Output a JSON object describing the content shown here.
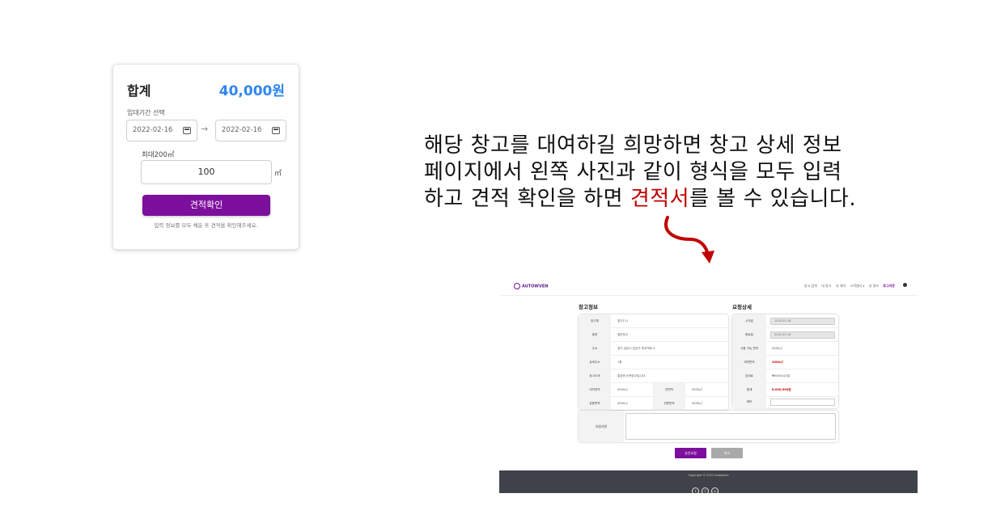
{
  "quote_card": {
    "sum_label": "합계",
    "sum_value": "40,000원",
    "period_label": "임대기간 선택",
    "date_from": "2022-02-16",
    "date_to": "2022-02-16",
    "arrow": "→",
    "max_label": "최대200㎡",
    "area_value": "100",
    "unit": "㎡",
    "button_label": "견적확인",
    "hint": "입력 정보를 모두 채운 후 견적을 확인해주세요."
  },
  "explanation": {
    "line1": "해당 창고를 대여하길 희망하면 창고 상세 정보",
    "line2": "페이지에서 왼쪽 사진과 같이 형식을 모두 입력",
    "line3_pre": "하고 견적 확인을 하면 ",
    "line3_highlight": "견적서",
    "line3_post": "를 볼 수 있습니다.",
    "highlight_color": "#c00000"
  },
  "screenshot": {
    "logo": "AUTOWVEN",
    "nav": [
      "창고 검색",
      "내 창고",
      "내 계약",
      "고객센터 ▾",
      "내 정보",
      "로그아웃"
    ],
    "warehouse_title": "창고정보",
    "request_title": "요청상세",
    "warehouse_rows": [
      {
        "k": "창고명",
        "v": "창고111"
      },
      {
        "k": "종류",
        "v": "일반창고"
      },
      {
        "k": "주소",
        "v": "경기 성남시 분당구 판교역로 4"
      },
      {
        "k": "상세주소",
        "v": "1층"
      },
      {
        "k": "창고소개",
        "v": "깔끔한 신축창고입니다."
      }
    ],
    "warehouse_pairs": [
      {
        "k1": "대지면적",
        "v1": "4000㎡",
        "k2": "연면적",
        "v2": "4000㎡"
      },
      {
        "k1": "공용면적",
        "v1": "4000㎡",
        "k2": "전용면적",
        "v2": "4000㎡"
      }
    ],
    "request_rows": [
      {
        "k": "시작일",
        "v": "2022-02-16"
      },
      {
        "k": "종료일",
        "v": "2022-02-16"
      },
      {
        "k": "사용 가능 면적",
        "v": "4000㎡"
      },
      {
        "k": "계약면적",
        "v": "2000㎡"
      },
      {
        "k": "임대료",
        "v": "₩4000/㎡/일"
      },
      {
        "k": "합계",
        "v": "8,000,000원"
      },
      {
        "k": "메모",
        "v": ""
      }
    ],
    "memo_label": "요청사항",
    "approve_label": "승인요청",
    "cancel_label": "취소",
    "copyright": "Copyright © 2022 Autowven",
    "social": [
      "t",
      "f",
      "◎"
    ]
  }
}
